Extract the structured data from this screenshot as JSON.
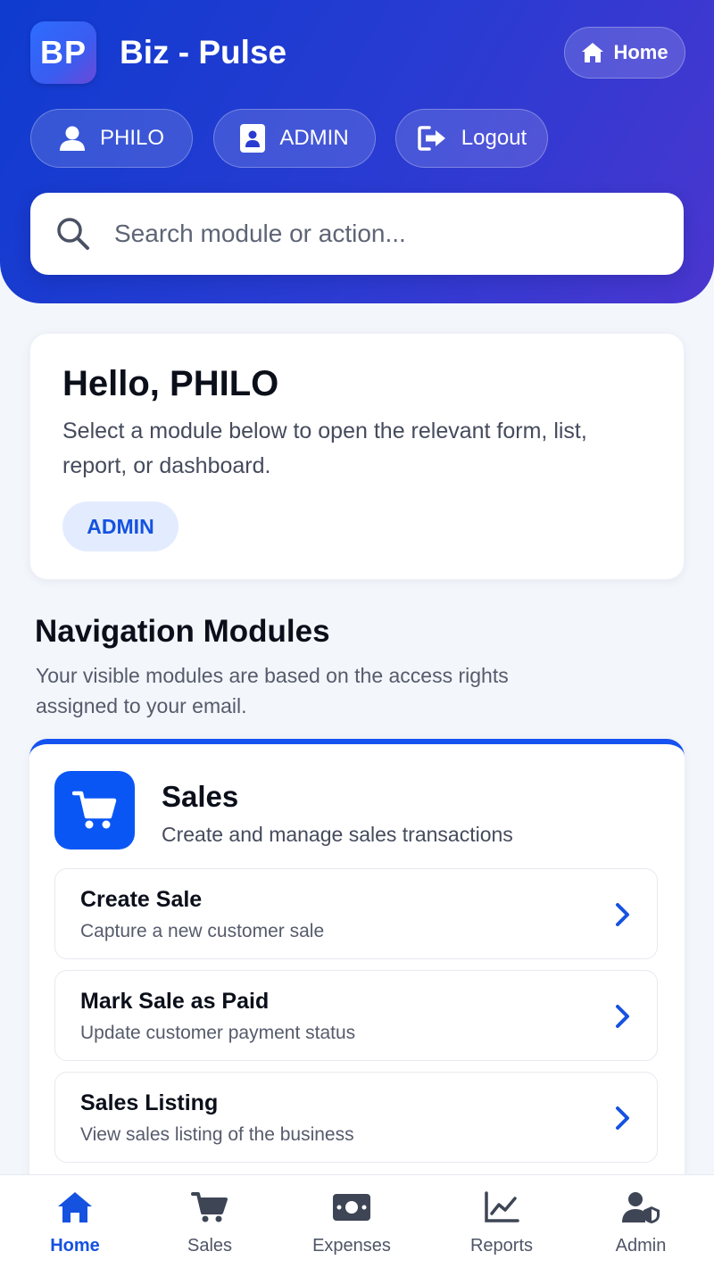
{
  "header": {
    "logo_text": "BP",
    "app_title": "Biz - Pulse",
    "home_label": "Home",
    "user_label": "PHILO",
    "role_label": "ADMIN",
    "logout_label": "Logout",
    "search_placeholder": "Search module or action..."
  },
  "hello": {
    "title": "Hello, PHILO",
    "text": "Select a module below to open the relevant form, list, report, or dashboard.",
    "role_badge": "ADMIN"
  },
  "navigation": {
    "title": "Navigation Modules",
    "description": "Your visible modules are based on the access rights assigned to your email."
  },
  "module": {
    "title": "Sales",
    "description": "Create and manage sales transactions",
    "accent": "#0a56f5",
    "actions": [
      {
        "title": "Create Sale",
        "description": "Capture a new customer sale"
      },
      {
        "title": "Mark Sale as Paid",
        "description": "Update customer payment status"
      },
      {
        "title": "Sales Listing",
        "description": "View sales listing of the business"
      }
    ]
  },
  "bottom_nav": {
    "items": [
      {
        "label": "Home",
        "icon": "home-icon",
        "active": true
      },
      {
        "label": "Sales",
        "icon": "cart-icon",
        "active": false
      },
      {
        "label": "Expenses",
        "icon": "cash-icon",
        "active": false
      },
      {
        "label": "Reports",
        "icon": "chart-line-icon",
        "active": false
      },
      {
        "label": "Admin",
        "icon": "user-shield-icon",
        "active": false
      }
    ]
  },
  "colors": {
    "primary": "#1552e0",
    "header_gradient_start": "#0f3bcf",
    "header_gradient_end": "#4a36cf"
  }
}
